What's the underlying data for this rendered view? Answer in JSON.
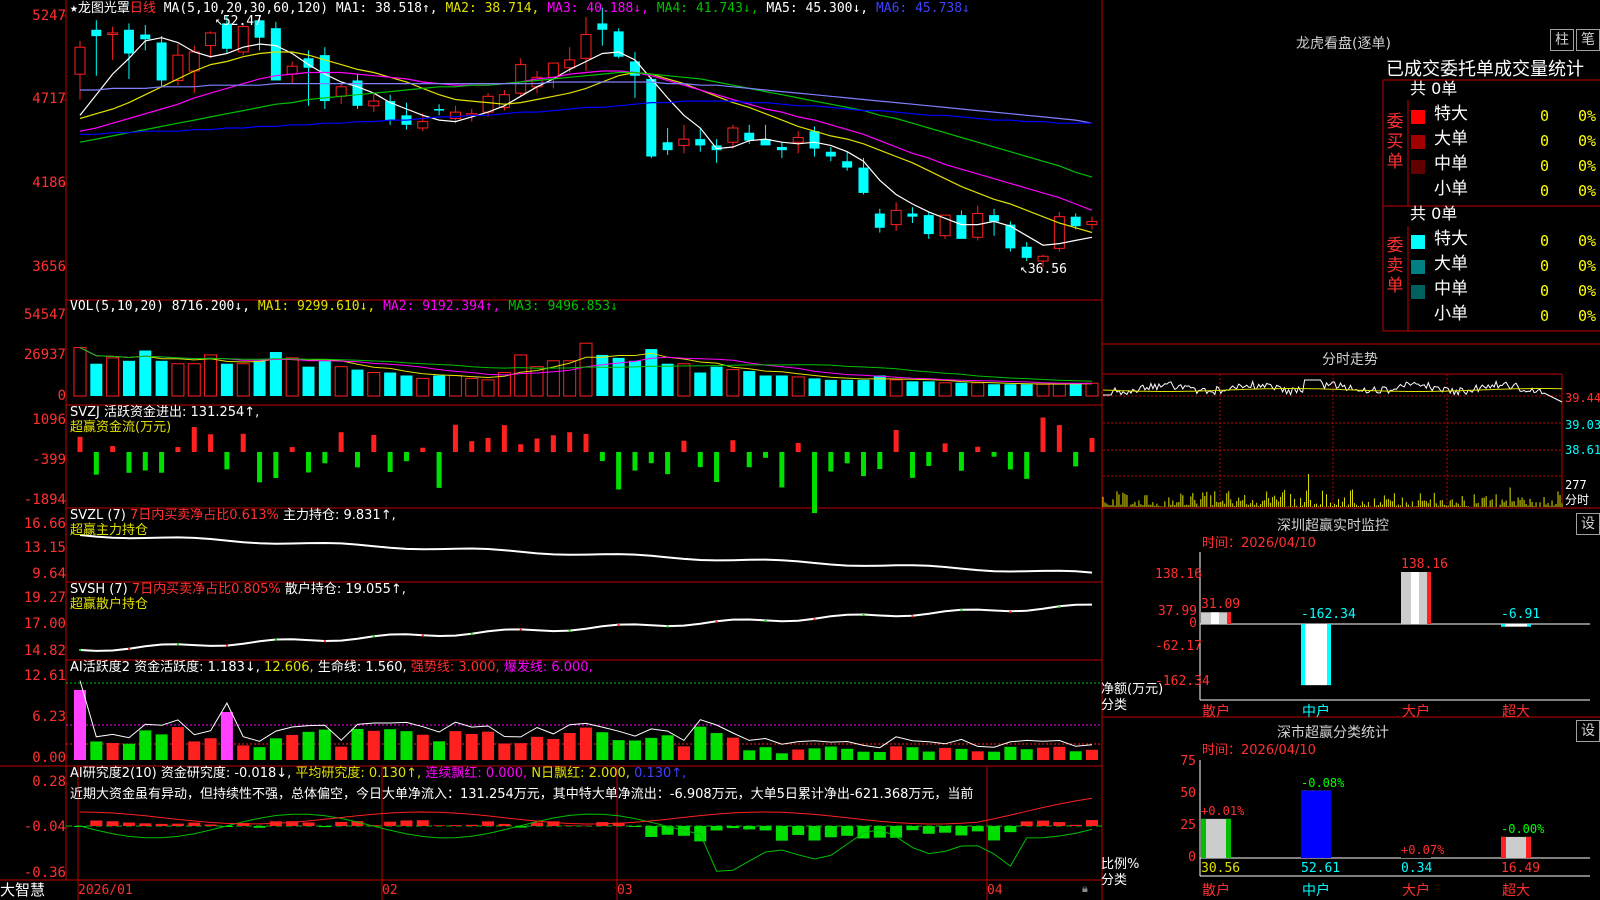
{
  "colors": {
    "up": "#ff2020",
    "down": "#00ffff",
    "grid": "#c00000",
    "ma1": "#ffffff",
    "ma2": "#e0e000",
    "ma3": "#ff00ff",
    "ma4": "#00c000",
    "ma5": "#8080ff",
    "ma6": "#0000ff"
  },
  "header": {
    "star": "★",
    "stock_name": "龙图光罩",
    "period": "日线",
    "ma_label": "MA(5,10,20,30,60,120)",
    "ma1": "MA1: 38.518↑,",
    "ma2": "MA2: 38.714,",
    "ma3": "MA3: 40.188↓,",
    "ma4": "MA4: 41.743↓,",
    "ma5": "MA5: 45.300↓,",
    "ma6": "MA6: 45.738↓",
    "high_mark": "52.47",
    "low_mark": "36.56"
  },
  "price_axis": [
    "5247",
    "4717",
    "4186",
    "3656"
  ],
  "vol": {
    "label": "VOL(5,10,20)",
    "value": "8716.200↓,",
    "ma1": "MA1: 9299.610↓,",
    "ma2": "MA2: 9192.394↑,",
    "ma3": "MA3: 9496.853↓",
    "axis": [
      "54547",
      "26937",
      "0"
    ]
  },
  "svzj": {
    "label": "SVZJ  活跃资金进出: 131.254↑,",
    "sub": "超赢资金流(万元)",
    "axis": [
      "1096",
      "-399",
      "-1894"
    ]
  },
  "svzl": {
    "label": "SVZL (7)",
    "pct": "7日内买卖净占比0.613%",
    "hold": "主力持仓: 9.831↑,",
    "sub": "超赢主力持仓",
    "axis": [
      "16.66",
      "13.15",
      "9.64"
    ]
  },
  "svsh": {
    "label": "SVSH (7)",
    "pct": "7日内买卖净占比0.805%",
    "hold": "散户持仓: 19.055↑,",
    "sub": "超赢散户持仓",
    "axis": [
      "19.27",
      "17.00",
      "14.82"
    ]
  },
  "ai1": {
    "label": "AI活跃度2",
    "a": "资金活跃度: 1.183↓,",
    "b": "12.606,",
    "c": "生命线: 1.560,",
    "d": "强势线: 3.000,",
    "e": "爆发线: 6.000,",
    "axis": [
      "12.61",
      "6.23",
      "0.00"
    ]
  },
  "ai2": {
    "label": "AI研究度2(10)",
    "a": "资金研究度: -0.018↓,",
    "b": "平均研究度: 0.130↑,",
    "c": "连续飘红: 0.000,",
    "d": "N日飘红: 2.000,",
    "e": "0.130↑,",
    "text": "近期大资金虽有异动，但持续性不强，总体偏空，今日大单净流入：131.254万元，其中特大单净流出：-6.908万元，大单5日累计净出-621.368万元，当前",
    "axis": [
      "0.28",
      "-0.04",
      "-0.36"
    ]
  },
  "dates": [
    "2026/01",
    "02",
    "03",
    "04"
  ],
  "logo": "大智慧",
  "right": {
    "lhkp_title": "龙虎看盘(逐单)",
    "btn_zhu": "柱",
    "btn_bi": "笔",
    "stats_title": "已成交委托单成交量统计",
    "buy": {
      "side": "委买单",
      "total": "共 0单",
      "rows": [
        {
          "name": "特大",
          "n": "0",
          "p": "0%",
          "color": "#ff0000"
        },
        {
          "name": "大单",
          "n": "0",
          "p": "0%",
          "color": "#a00000"
        },
        {
          "name": "中单",
          "n": "0",
          "p": "0%",
          "color": "#600000"
        },
        {
          "name": "小单",
          "n": "0",
          "p": "0%",
          "color": "#000000"
        }
      ]
    },
    "sell": {
      "side": "委卖单",
      "total": "共 0单",
      "rows": [
        {
          "name": "特大",
          "n": "0",
          "p": "0%",
          "color": "#00ffff"
        },
        {
          "name": "大单",
          "n": "0",
          "p": "0%",
          "color": "#008080"
        },
        {
          "name": "中单",
          "n": "0",
          "p": "0%",
          "color": "#006060"
        },
        {
          "name": "小单",
          "n": "0",
          "p": "0%",
          "color": "#000000"
        }
      ]
    },
    "fenshi": {
      "title": "分时走势",
      "axis": [
        "39.44",
        "39.03",
        "38.61"
      ],
      "vol_top": "277",
      "vol_lbl": "分时"
    },
    "monitor": {
      "title": "深圳超赢实时监控",
      "btn": "设",
      "date": "时间：2026/04/10",
      "axis": [
        "138.16",
        "37.99",
        "0",
        "-62.17",
        "-162.34"
      ],
      "unit": "净额(万元)",
      "cat_lbl": "分类",
      "cats": [
        "散户",
        "中户",
        "大户",
        "超大"
      ],
      "values": [
        31.09,
        -162.34,
        138.16,
        -6.91
      ],
      "val_labels": [
        "31.09",
        "-162.34",
        "138.16",
        "-6.91"
      ]
    },
    "classify": {
      "title": "深市超赢分类统计",
      "btn": "设",
      "date": "时间：2026/04/10",
      "axis": [
        "75",
        "50",
        "25",
        "0"
      ],
      "unit": "比例%",
      "cat_lbl": "分类",
      "cats": [
        "散户",
        "中户",
        "大户",
        "超大"
      ],
      "values": [
        30.56,
        52.61,
        0.34,
        16.49
      ],
      "val_labels": [
        "30.56",
        "52.61",
        "0.34",
        "16.49"
      ],
      "chg": [
        "+0.01%",
        "-0.08%",
        "+0.07%",
        "-0.00%"
      ]
    }
  },
  "chart_data": {
    "type": "candlestick",
    "title": "龙图光罩 日线",
    "xlabel": "",
    "ylabel": "",
    "ylim": [
      36.0,
      53.0
    ],
    "x_ticks": [
      "2026/01",
      "02",
      "03",
      "04"
    ],
    "ohlc": [
      [
        48.8,
        50.9,
        47.2,
        50.5
      ],
      [
        51.6,
        52.2,
        48.7,
        51.2
      ],
      [
        51.3,
        51.8,
        49.7,
        51.4
      ],
      [
        51.6,
        52.0,
        48.5,
        50.1
      ],
      [
        51.3,
        51.9,
        50.3,
        51.0
      ],
      [
        50.8,
        51.2,
        48.0,
        48.4
      ],
      [
        48.4,
        50.7,
        48.1,
        50.0
      ],
      [
        49.0,
        50.6,
        47.6,
        50.2
      ],
      [
        50.6,
        51.5,
        49.8,
        51.4
      ],
      [
        52.0,
        52.5,
        50.1,
        50.4
      ],
      [
        50.2,
        52.0,
        50.0,
        51.8
      ],
      [
        52.2,
        52.5,
        50.3,
        51.1
      ],
      [
        51.7,
        52.1,
        48.5,
        48.4
      ],
      [
        48.8,
        49.6,
        48.2,
        49.3
      ],
      [
        49.8,
        50.3,
        46.8,
        49.2
      ],
      [
        50.0,
        50.5,
        46.6,
        47.1
      ],
      [
        47.4,
        48.2,
        46.9,
        48.0
      ],
      [
        48.4,
        48.8,
        46.6,
        46.8
      ],
      [
        46.8,
        47.6,
        46.4,
        47.1
      ],
      [
        47.1,
        47.5,
        45.6,
        45.9
      ],
      [
        46.2,
        47.0,
        45.3,
        45.6
      ],
      [
        45.4,
        46.3,
        45.2,
        45.8
      ],
      [
        46.6,
        46.9,
        46.2,
        46.5
      ],
      [
        46.0,
        46.8,
        45.7,
        46.4
      ],
      [
        46.2,
        46.6,
        45.8,
        46.3
      ],
      [
        46.4,
        47.6,
        46.1,
        47.4
      ],
      [
        46.7,
        47.8,
        46.5,
        47.5
      ],
      [
        47.6,
        49.8,
        47.4,
        49.4
      ],
      [
        48.0,
        49.0,
        47.6,
        48.6
      ],
      [
        48.6,
        49.5,
        47.9,
        49.5
      ],
      [
        49.2,
        50.5,
        48.9,
        49.7
      ],
      [
        49.8,
        52.4,
        49.0,
        51.3
      ],
      [
        52.0,
        53.0,
        50.6,
        51.6
      ],
      [
        51.5,
        51.7,
        49.8,
        49.9
      ],
      [
        49.6,
        50.2,
        47.3,
        48.7
      ],
      [
        48.5,
        48.6,
        43.5,
        43.6
      ],
      [
        44.5,
        45.4,
        43.7,
        44.0
      ],
      [
        44.3,
        45.6,
        43.8,
        44.7
      ],
      [
        44.7,
        45.4,
        43.9,
        44.3
      ],
      [
        44.3,
        44.7,
        43.2,
        44.0
      ],
      [
        44.5,
        45.6,
        44.1,
        45.4
      ],
      [
        45.1,
        45.6,
        44.4,
        44.6
      ],
      [
        44.7,
        45.6,
        44.3,
        44.3
      ],
      [
        44.2,
        44.5,
        43.5,
        44.0
      ],
      [
        44.5,
        45.2,
        43.8,
        44.8
      ],
      [
        45.2,
        45.5,
        43.6,
        44.1
      ],
      [
        43.9,
        44.2,
        43.3,
        43.6
      ],
      [
        43.3,
        43.9,
        42.7,
        42.9
      ],
      [
        42.9,
        43.5,
        41.2,
        41.3
      ],
      [
        40.0,
        40.3,
        38.8,
        39.1
      ],
      [
        39.3,
        40.7,
        38.9,
        40.2
      ],
      [
        40.0,
        40.4,
        39.4,
        39.8
      ],
      [
        39.9,
        40.1,
        38.4,
        38.7
      ],
      [
        38.6,
        39.9,
        38.4,
        39.9
      ],
      [
        39.9,
        40.2,
        38.4,
        38.4
      ],
      [
        38.5,
        40.5,
        38.3,
        40.0
      ],
      [
        39.9,
        40.3,
        38.6,
        39.5
      ],
      [
        39.3,
        39.5,
        37.6,
        37.8
      ],
      [
        37.9,
        38.2,
        37.0,
        37.2
      ],
      [
        37.0,
        37.4,
        36.6,
        37.3
      ],
      [
        37.8,
        40.1,
        37.6,
        39.8
      ],
      [
        39.8,
        40.0,
        39.0,
        39.2
      ],
      [
        39.3,
        39.8,
        39.0,
        39.5
      ]
    ],
    "ma_lines": {
      "MA1": [
        46.2,
        47.5,
        48.8,
        49.8,
        50.9,
        51.1,
        50.8,
        50.2,
        49.9,
        50.1,
        50.5,
        50.7,
        50.6,
        50.1,
        49.4,
        48.8,
        48.3,
        48.0,
        47.6,
        47.0,
        46.6,
        46.2,
        45.9,
        45.8,
        46.1,
        46.4,
        46.8,
        47.4,
        48.0,
        48.5,
        49.1,
        49.6,
        50.1,
        50.2,
        49.7,
        48.5,
        47.3,
        46.2,
        45.4,
        44.1,
        44.2,
        44.6,
        44.7,
        44.5,
        44.4,
        44.5,
        44.3,
        43.9,
        43.3,
        42.1,
        41.2,
        40.6,
        40.1,
        39.7,
        39.3,
        39.3,
        39.5,
        39.2,
        38.6,
        38.0,
        38.1,
        38.3,
        38.5
      ],
      "MA2": [
        46.0,
        46.3,
        46.6,
        47.0,
        47.5,
        48.0,
        48.5,
        49.0,
        49.4,
        49.6,
        49.9,
        50.1,
        50.2,
        50.2,
        50.0,
        49.7,
        49.4,
        49.1,
        48.9,
        48.6,
        48.3,
        47.9,
        47.5,
        47.2,
        47.1,
        47.0,
        46.9,
        47.0,
        47.2,
        47.4,
        47.6,
        47.9,
        48.3,
        48.7,
        48.9,
        48.8,
        48.5,
        48.2,
        47.8,
        47.4,
        47.0,
        46.7,
        46.3,
        45.9,
        45.5,
        45.2,
        44.9,
        44.7,
        44.4,
        44.0,
        43.6,
        43.2,
        42.7,
        42.2,
        41.7,
        41.3,
        40.9,
        40.6,
        40.2,
        39.8,
        39.4,
        39.1,
        38.8
      ],
      "MA3": [
        45.2,
        45.4,
        45.7,
        46.0,
        46.3,
        46.6,
        46.9,
        47.3,
        47.6,
        47.9,
        48.2,
        48.5,
        48.7,
        48.8,
        48.9,
        48.9,
        48.9,
        48.8,
        48.7,
        48.6,
        48.5,
        48.3,
        48.2,
        48.1,
        48.1,
        48.1,
        48.2,
        48.3,
        48.5,
        48.6,
        48.8,
        48.9,
        49.0,
        49.0,
        48.9,
        48.7,
        48.4,
        48.1,
        47.8,
        47.5,
        47.2,
        46.9,
        46.6,
        46.4,
        46.1,
        45.9,
        45.6,
        45.3,
        45.0,
        44.6,
        44.2,
        43.8,
        43.5,
        43.1,
        42.8,
        42.5,
        42.2,
        41.9,
        41.6,
        41.3,
        41.0,
        40.6,
        40.2
      ],
      "MA4": [
        44.5,
        44.7,
        44.9,
        45.1,
        45.3,
        45.5,
        45.7,
        45.9,
        46.1,
        46.3,
        46.5,
        46.7,
        46.9,
        47.0,
        47.2,
        47.3,
        47.4,
        47.5,
        47.6,
        47.7,
        47.8,
        47.9,
        48.0,
        48.0,
        48.1,
        48.1,
        48.2,
        48.3,
        48.4,
        48.5,
        48.6,
        48.7,
        48.8,
        48.9,
        48.9,
        48.8,
        48.7,
        48.6,
        48.5,
        48.3,
        48.1,
        47.9,
        47.7,
        47.5,
        47.3,
        47.1,
        46.9,
        46.7,
        46.5,
        46.2,
        46.0,
        45.7,
        45.4,
        45.1,
        44.8,
        44.5,
        44.2,
        43.9,
        43.6,
        43.3,
        43.0,
        42.6,
        42.3
      ],
      "MA5": [
        47.8,
        47.8,
        47.9,
        47.9,
        47.9,
        48.0,
        48.0,
        48.0,
        48.1,
        48.1,
        48.1,
        48.1,
        48.2,
        48.2,
        48.2,
        48.2,
        48.2,
        48.2,
        48.2,
        48.2,
        48.2,
        48.2,
        48.2,
        48.2,
        48.2,
        48.2,
        48.2,
        48.2,
        48.2,
        48.3,
        48.3,
        48.3,
        48.3,
        48.3,
        48.3,
        48.3,
        48.2,
        48.2,
        48.1,
        48.1,
        48.0,
        47.9,
        47.8,
        47.7,
        47.6,
        47.5,
        47.4,
        47.3,
        47.2,
        47.1,
        47.0,
        46.9,
        46.8,
        46.7,
        46.6,
        46.5,
        46.4,
        46.3,
        46.2,
        46.1,
        46.0,
        45.9,
        45.7
      ],
      "MA6": [
        45.0,
        45.0,
        45.1,
        45.1,
        45.2,
        45.2,
        45.2,
        45.3,
        45.3,
        45.4,
        45.4,
        45.5,
        45.5,
        45.6,
        45.6,
        45.7,
        45.7,
        45.8,
        45.8,
        45.9,
        45.9,
        46.0,
        46.1,
        46.1,
        46.2,
        46.2,
        46.3,
        46.4,
        46.4,
        46.5,
        46.6,
        46.7,
        46.7,
        46.8,
        46.9,
        47.0,
        47.0,
        47.1,
        47.1,
        47.1,
        47.1,
        47.0,
        47.0,
        46.9,
        46.8,
        46.8,
        46.7,
        46.6,
        46.5,
        46.5,
        46.4,
        46.3,
        46.2,
        46.2,
        46.1,
        46.0,
        45.9,
        45.9,
        45.8,
        45.8,
        45.7,
        45.7,
        45.7
      ]
    },
    "volume": [
      33000,
      22000,
      26000,
      24000,
      31000,
      24000,
      22000,
      22000,
      28000,
      22000,
      22000,
      24000,
      30000,
      26000,
      20000,
      24000,
      20000,
      18000,
      16000,
      16000,
      14000,
      12000,
      14000,
      14000,
      12000,
      11000,
      16000,
      28000,
      20000,
      24000,
      24000,
      36000,
      28000,
      26000,
      24000,
      32000,
      22000,
      22000,
      16000,
      20000,
      18000,
      17000,
      14000,
      14000,
      13000,
      12000,
      11000,
      11000,
      11000,
      14000,
      11000,
      10000,
      10000,
      9000,
      9000,
      9000,
      8000,
      8000,
      8000,
      8000,
      8600,
      8700,
      8716
    ]
  }
}
